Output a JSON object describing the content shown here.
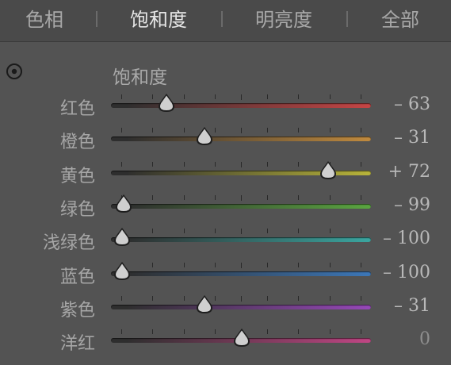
{
  "tabs": [
    {
      "label": "色相"
    },
    {
      "label": "饱和度"
    },
    {
      "label": "明亮度"
    },
    {
      "label": "全部"
    }
  ],
  "active_tab": "饱和度",
  "section_title": "饱和度",
  "icons": {
    "target": "target-adjustment-icon"
  },
  "sliders": [
    {
      "label": "红色",
      "value": "– 63",
      "amount": -63,
      "colors": [
        "#2e2e2e",
        "#c64545"
      ]
    },
    {
      "label": "橙色",
      "value": "– 31",
      "amount": -31,
      "colors": [
        "#2e2e2e",
        "#c08a3e"
      ]
    },
    {
      "label": "黄色",
      "value": "+ 72",
      "amount": 72,
      "colors": [
        "#2e2e2e",
        "#b8b43a"
      ]
    },
    {
      "label": "绿色",
      "value": "– 99",
      "amount": -99,
      "colors": [
        "#2e2e2e",
        "#5aa640"
      ]
    },
    {
      "label": "浅绿色",
      "value": "– 100",
      "amount": -100,
      "colors": [
        "#2e2e2e",
        "#3aa6a0"
      ]
    },
    {
      "label": "蓝色",
      "value": "– 100",
      "amount": -100,
      "colors": [
        "#2e2e2e",
        "#3c77b8"
      ]
    },
    {
      "label": "紫色",
      "value": "– 31",
      "amount": -31,
      "colors": [
        "#2e2e2e",
        "#9648b8"
      ]
    },
    {
      "label": "洋红",
      "value": "0",
      "amount": 0,
      "colors": [
        "#2e2e2e",
        "#c04684"
      ]
    }
  ]
}
